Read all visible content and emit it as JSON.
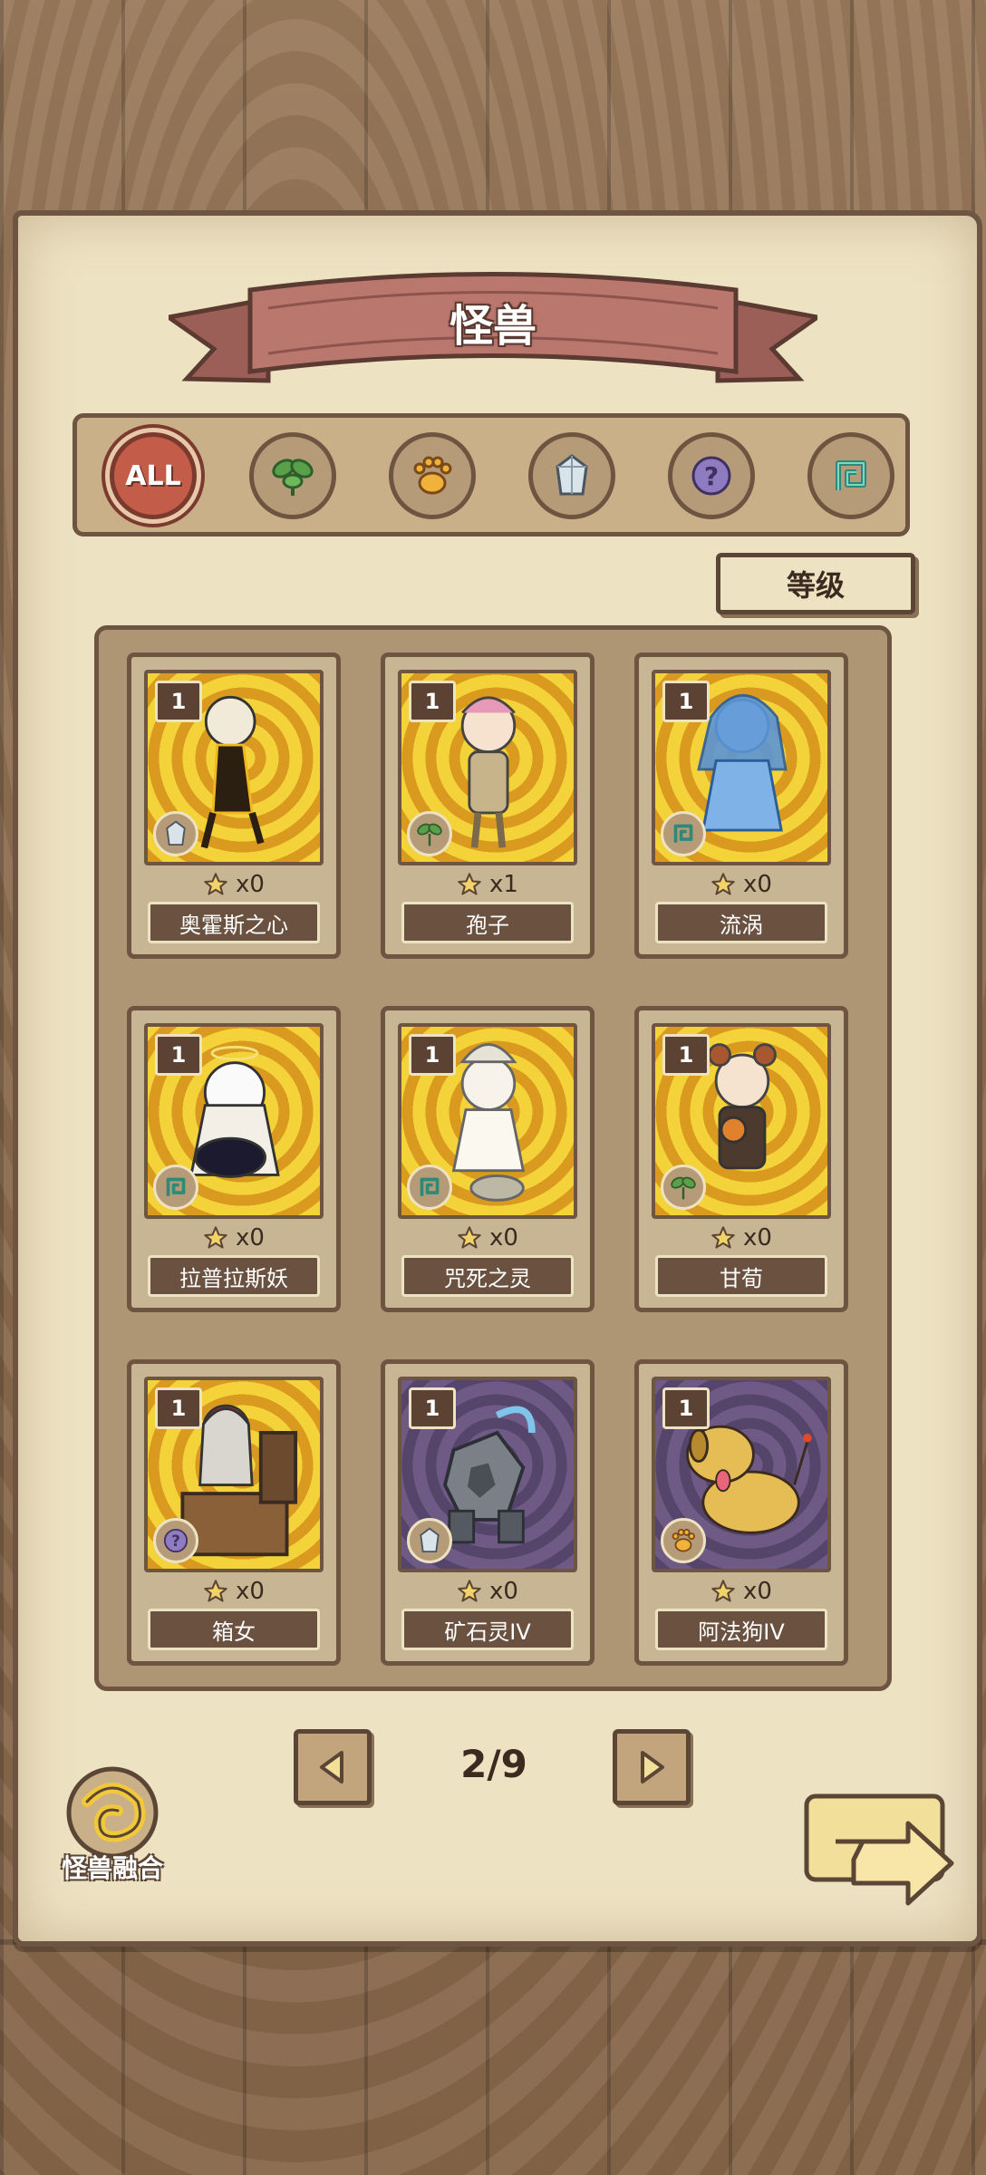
{
  "header": {
    "title": "怪兽"
  },
  "filters": [
    {
      "id": "all",
      "label": "ALL",
      "icon": "all-text",
      "active": true
    },
    {
      "id": "plant",
      "label": "",
      "icon": "leaf-icon",
      "active": false
    },
    {
      "id": "beast",
      "label": "",
      "icon": "paw-icon",
      "active": false
    },
    {
      "id": "mineral",
      "label": "",
      "icon": "crystal-icon",
      "active": false
    },
    {
      "id": "unknown",
      "label": "",
      "icon": "question-icon",
      "active": false
    },
    {
      "id": "spirit",
      "label": "",
      "icon": "swirl-icon",
      "active": false
    }
  ],
  "sort": {
    "label": "等级"
  },
  "cards": [
    {
      "level": "1",
      "count": "x0",
      "name": "奥霍斯之心",
      "type": "crystal-icon",
      "bg": "gold"
    },
    {
      "level": "1",
      "count": "x1",
      "name": "孢子",
      "type": "leaf-icon",
      "bg": "gold"
    },
    {
      "level": "1",
      "count": "x0",
      "name": "流涡",
      "type": "swirl-icon",
      "bg": "gold"
    },
    {
      "level": "1",
      "count": "x0",
      "name": "拉普拉斯妖",
      "type": "swirl-icon",
      "bg": "gold"
    },
    {
      "level": "1",
      "count": "x0",
      "name": "咒死之灵",
      "type": "swirl-icon",
      "bg": "gold"
    },
    {
      "level": "1",
      "count": "x0",
      "name": "甘荀",
      "type": "leaf-icon",
      "bg": "gold"
    },
    {
      "level": "1",
      "count": "x0",
      "name": "箱女",
      "type": "question-icon",
      "bg": "gold"
    },
    {
      "level": "1",
      "count": "x0",
      "name": "矿石灵IV",
      "type": "crystal-icon",
      "bg": "purple"
    },
    {
      "level": "1",
      "count": "x0",
      "name": "阿法狗IV",
      "type": "paw-icon",
      "bg": "purple"
    }
  ],
  "pager": {
    "page": "2/9"
  },
  "fusion": {
    "label": "怪兽融合"
  },
  "colors": {
    "paper": "#ede2c2",
    "ink": "#6d5541",
    "banner": "#b9776e",
    "active": "#c45c4a"
  }
}
